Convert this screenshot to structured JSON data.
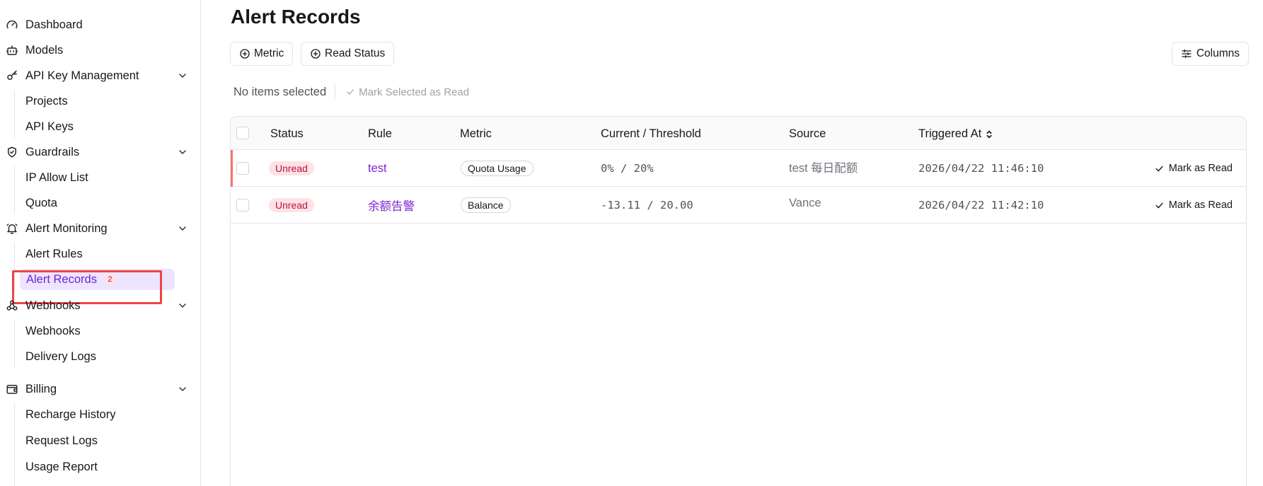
{
  "sidebar": {
    "dashboard": "Dashboard",
    "models": "Models",
    "api_key_management": "API Key Management",
    "projects": "Projects",
    "api_keys": "API Keys",
    "guardrails": "Guardrails",
    "ip_allow_list": "IP Allow List",
    "quota": "Quota",
    "alert_monitoring": "Alert Monitoring",
    "alert_rules": "Alert Rules",
    "alert_records": "Alert Records",
    "alert_records_count": "2",
    "webhooks_group": "Webhooks",
    "webhooks": "Webhooks",
    "delivery_logs": "Delivery Logs",
    "billing": "Billing",
    "recharge_history": "Recharge History",
    "request_logs": "Request Logs",
    "usage_report": "Usage Report"
  },
  "page": {
    "title": "Alert Records"
  },
  "toolbar": {
    "metric_filter": "Metric",
    "read_status_filter": "Read Status",
    "columns": "Columns"
  },
  "selection": {
    "status_text": "No items selected",
    "mark_selected": "Mark Selected as Read"
  },
  "table": {
    "headers": {
      "status": "Status",
      "rule": "Rule",
      "metric": "Metric",
      "current_threshold": "Current / Threshold",
      "source": "Source",
      "triggered_at": "Triggered At"
    },
    "rows": [
      {
        "status": "Unread",
        "rule": "test",
        "metric": "Quota Usage",
        "current_threshold": "0% / 20%",
        "source": "test 每日配额",
        "triggered_at": "2026/04/22 11:46:10",
        "action": "Mark as Read"
      },
      {
        "status": "Unread",
        "rule": "余额告警",
        "metric": "Balance",
        "current_threshold": "-13.11 / 20.00",
        "source": "Vance",
        "triggered_at": "2026/04/22 11:42:10",
        "action": "Mark as Read"
      }
    ]
  },
  "colors": {
    "accent": "#6d28d9",
    "active_bg": "#ede4ff",
    "unread_bg": "#fde2e6",
    "unread_text": "#be123c",
    "highlight_border": "#ef4444"
  }
}
